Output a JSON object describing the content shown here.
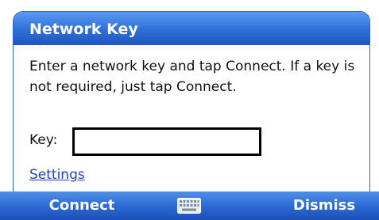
{
  "dialog": {
    "title": "Network Key",
    "message": "Enter a network key and tap Connect. If a key is not required, just tap Connect.",
    "key_label": "Key:",
    "key_value": "",
    "settings_link": "Settings"
  },
  "softkeys": {
    "left": "Connect",
    "right": "Dismiss",
    "center_icon": "keyboard-icon"
  },
  "colors": {
    "accent": "#2f6fd6",
    "link": "#1f43c4"
  }
}
